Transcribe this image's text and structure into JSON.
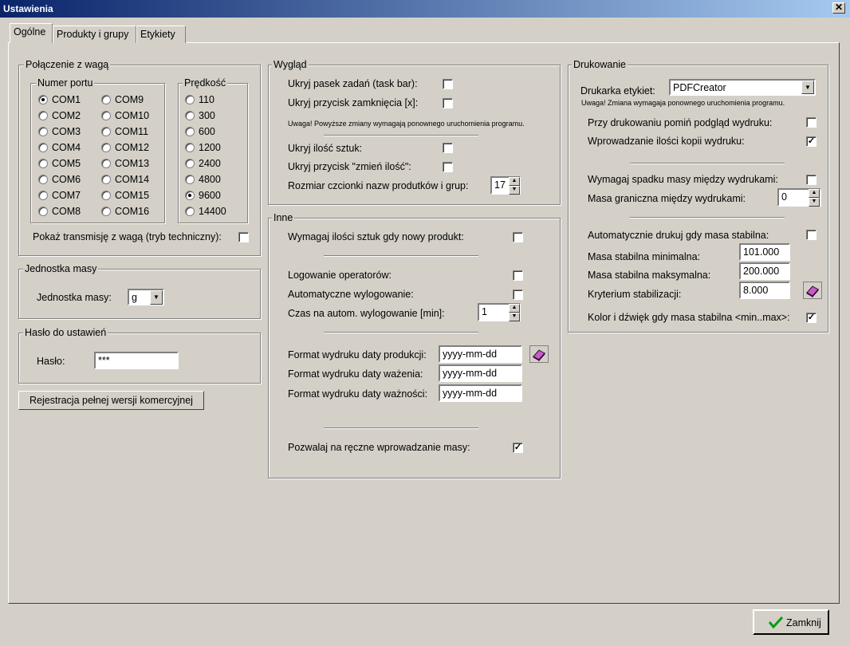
{
  "window": {
    "title": "Ustawienia",
    "close": "✕"
  },
  "tabs": [
    "Ogólne",
    "Produkty i grupy",
    "Etykiety"
  ],
  "connection": {
    "legend": "Połączenie z wagą",
    "port_legend": "Numer portu",
    "ports": [
      "COM1",
      "COM2",
      "COM3",
      "COM4",
      "COM5",
      "COM6",
      "COM7",
      "COM8",
      "COM9",
      "COM10",
      "COM11",
      "COM12",
      "COM13",
      "COM14",
      "COM15",
      "COM16"
    ],
    "selected_port": "COM1",
    "speed_legend": "Prędkość",
    "speeds": [
      "110",
      "300",
      "600",
      "1200",
      "2400",
      "4800",
      "9600",
      "14400"
    ],
    "selected_speed": "9600",
    "transmission_label": "Pokaż transmisję z wagą (tryb techniczny):",
    "transmission_checked": false
  },
  "unit": {
    "legend": "Jednostka masy",
    "label": "Jednostka masy:",
    "value": "g"
  },
  "password": {
    "legend": "Hasło do ustawień",
    "label": "Hasło:",
    "value": "***"
  },
  "register_button": "Rejestracja pełnej wersji komercyjnej",
  "look": {
    "legend": "Wygląd",
    "hide_taskbar": "Ukryj pasek zadań (task bar):",
    "hide_close": "Ukryj przycisk zamknięcia [x]:",
    "note": "Uwaga! Powyższe zmiany wymagają ponownego uruchomienia programu.",
    "hide_count": "Ukryj ilość sztuk:",
    "hide_change": "Ukryj przycisk \"zmień ilość\":",
    "font_size_label": "Rozmiar czcionki nazw produtków i grup:",
    "font_size": "17"
  },
  "other": {
    "legend": "Inne",
    "require_count": "Wymagaj ilości sztuk gdy nowy produkt:",
    "operator_log": "Logowanie operatorów:",
    "auto_logout": "Automatyczne wylogowanie:",
    "logout_time_label": "Czas na autom. wylogowanie [min]:",
    "logout_time": "1",
    "prod_date_label": "Format wydruku daty produkcji:",
    "prod_date": "yyyy-mm-dd",
    "weigh_date_label": "Format wydruku daty ważenia:",
    "weigh_date": "yyyy-mm-dd",
    "expiry_date_label": "Format wydruku daty ważności:",
    "expiry_date": "yyyy-mm-dd",
    "manual_mass": "Pozwalaj na ręczne wprowadzanie masy:",
    "manual_mass_checked": true
  },
  "printing": {
    "legend": "Drukowanie",
    "printer_label": "Drukarka etykiet:",
    "printer": "PDFCreator",
    "note": "Uwaga! Zmiana wymagaja ponownego uruchomienia programu.",
    "skip_preview": "Przy drukowaniu pomiń podgląd wydruku:",
    "copies": "Wprowadzanie ilości kopii wydruku:",
    "copies_checked": true,
    "require_drop": "Wymagaj spadku masy między wydrukami:",
    "limit_label": "Masa graniczna między wydrukami:",
    "limit": "0",
    "auto_print": "Automatycznie drukuj gdy masa stabilna:",
    "min_label": "Masa stabilna minimalna:",
    "min": "101.000",
    "max_label": "Masa stabilna maksymalna:",
    "max": "200.000",
    "crit_label": "Kryterium stabilizacji:",
    "crit": "8.000",
    "color_sound": "Kolor i dźwięk gdy masa stabilna <min..max>:",
    "color_sound_checked": true
  },
  "close_button": "Zamknij",
  "check_mark": "✓"
}
